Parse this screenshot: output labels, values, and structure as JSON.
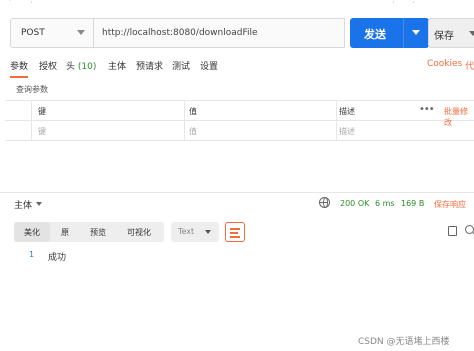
{
  "request": {
    "method": "POST",
    "url": "http://localhost:8080/downloadFile",
    "send_label": "发送",
    "save_label": "保存"
  },
  "tabs": [
    {
      "label": "参数",
      "active": true
    },
    {
      "label": "授权"
    },
    {
      "label": "头",
      "count": "(10)"
    },
    {
      "label": "主体"
    },
    {
      "label": "预请求"
    },
    {
      "label": "测试"
    },
    {
      "label": "设置"
    }
  ],
  "tabs_right": {
    "cookies": "Cookies",
    "code": "代"
  },
  "query_params": {
    "title": "查询参数",
    "columns": [
      "键",
      "值",
      "描述"
    ],
    "more": "•••",
    "bulk_edit": "批量修改",
    "row_placeholders": [
      "键",
      "值",
      "描述"
    ]
  },
  "response": {
    "body_label": "主体",
    "status": "200 OK",
    "time": "6 ms",
    "size": "169 B",
    "save_response": "保存响应",
    "view_modes": [
      "美化",
      "原",
      "预览",
      "可视化"
    ],
    "selected_view": "美化",
    "format": "Text",
    "lines": [
      {
        "number": "1",
        "text": "成功"
      }
    ]
  },
  "watermark": "CSDN @无语堵上西楼",
  "colors": {
    "accent": "#f26b3a",
    "send": "#1a73e8",
    "status_ok": "#2a8c2a"
  }
}
